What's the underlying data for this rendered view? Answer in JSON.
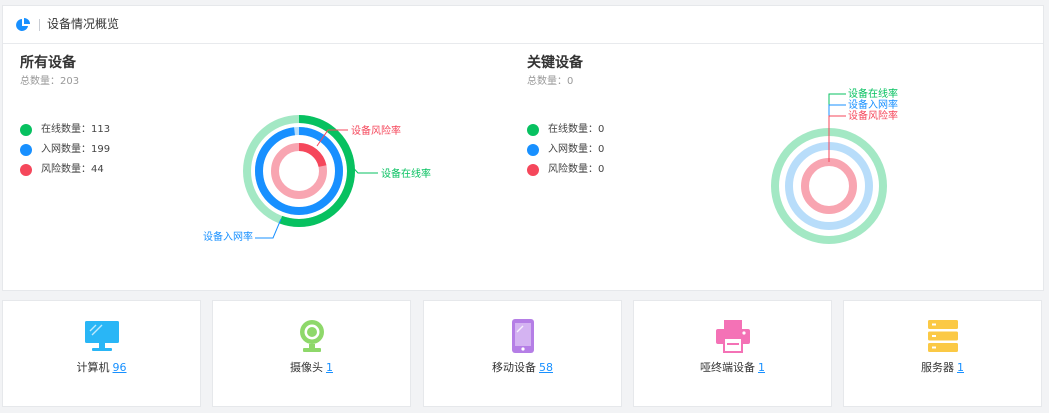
{
  "header": {
    "title": "设备情况概览",
    "icon": "pie-chart-icon"
  },
  "all_devices": {
    "title": "所有设备",
    "total_label": "总数量：",
    "total_value": "203",
    "legend": [
      {
        "text": "在线数量：113",
        "color": "#07c160"
      },
      {
        "text": "入网数量：199",
        "color": "#1890ff"
      },
      {
        "text": "风险数量：44",
        "color": "#f5475b"
      }
    ],
    "rings": {
      "online_rate": 113,
      "network_rate": 199,
      "risk_rate": 44,
      "total": 203,
      "labels": {
        "online": "设备在线率",
        "network": "设备入网率",
        "risk": "设备风险率"
      }
    }
  },
  "key_devices": {
    "title": "关键设备",
    "total_label": "总数量：",
    "total_value": "0",
    "legend": [
      {
        "text": "在线数量：0",
        "color": "#07c160"
      },
      {
        "text": "入网数量：0",
        "color": "#1890ff"
      },
      {
        "text": "风险数量：0",
        "color": "#f5475b"
      }
    ],
    "rings": {
      "online_rate": 0,
      "network_rate": 0,
      "risk_rate": 0,
      "total": 0,
      "labels": {
        "online": "设备在线率",
        "network": "设备入网率",
        "risk": "设备风险率"
      }
    }
  },
  "colors": {
    "online": "#07c160",
    "online_bg": "#a3e8c4",
    "network": "#1890ff",
    "network_bg": "#b8ddfa",
    "risk": "#f5475b",
    "risk_bg": "#f8a5b1"
  },
  "cards": [
    {
      "name": "计算机",
      "count": "96",
      "icon": "computer-icon",
      "color": "#29b6f6"
    },
    {
      "name": "摄像头",
      "count": "1",
      "icon": "webcam-icon",
      "color": "#8ed86a"
    },
    {
      "name": "移动设备",
      "count": "58",
      "icon": "mobile-device-icon",
      "color": "#b57ee6"
    },
    {
      "name": "哑终端设备",
      "count": "1",
      "icon": "printer-icon",
      "color": "#f472b6"
    },
    {
      "name": "服务器",
      "count": "1",
      "icon": "server-icon",
      "color": "#fbc945"
    }
  ]
}
